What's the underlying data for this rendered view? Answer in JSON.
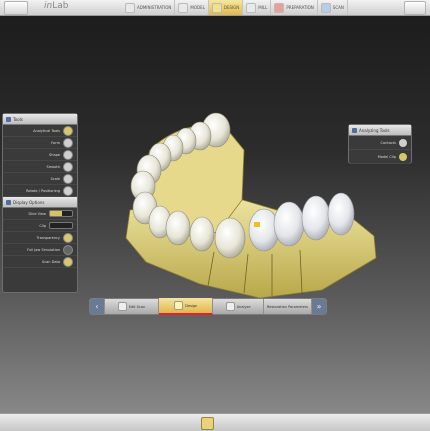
{
  "app": {
    "brand_prefix": "in",
    "brand_suffix": "Lab"
  },
  "tabs": [
    {
      "label": "ADMINISTRATION",
      "icon": "patient-icon"
    },
    {
      "label": "MODEL",
      "icon": "model-icon"
    },
    {
      "label": "DESIGN",
      "icon": "tooth-design-icon"
    },
    {
      "label": "MILL",
      "icon": "mill-icon"
    },
    {
      "label": "PREPARATION",
      "icon": "prep-icon"
    },
    {
      "label": "SCAN",
      "icon": "scan-icon"
    }
  ],
  "left_panel": {
    "tools_title": "Tools",
    "tools": [
      "Analytical Tools",
      "Form",
      "Shape",
      "Smooth",
      "Scale",
      "Rotate / Positioning"
    ],
    "display_title": "Display Options",
    "display": [
      "Slice View",
      "Clip",
      "Transparency",
      "Full Jaw Simulation",
      "Scan Data"
    ]
  },
  "right_panel": {
    "title": "Analyzing Tools",
    "items": [
      "Contacts",
      "Model Clip"
    ]
  },
  "bottom_toolbar": {
    "items": [
      "Edit Scan",
      "Design",
      "Analyze",
      "Restoration Parameters"
    ]
  }
}
